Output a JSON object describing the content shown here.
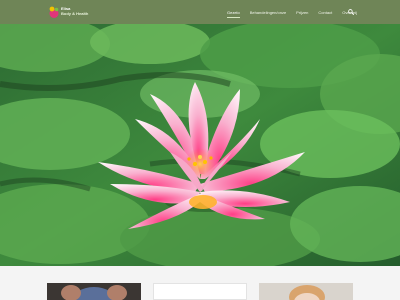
{
  "brand": {
    "line1": "Elisa",
    "line2": "Body & Health"
  },
  "menu": {
    "items": [
      {
        "label": "Gezelo",
        "active": true
      },
      {
        "label": "Behandelingen/onze",
        "active": false
      },
      {
        "label": "Prijzen",
        "active": false
      },
      {
        "label": "Contact",
        "active": false
      },
      {
        "label": "Over mij",
        "active": false
      }
    ]
  },
  "colors": {
    "navbar": "#6f8557",
    "accent": "#d7e8c3",
    "lotus_pink": "#f06aa0",
    "leaf_green": "#4f9a46"
  },
  "icons": {
    "search": "search-icon",
    "logo": "logo-icon"
  }
}
